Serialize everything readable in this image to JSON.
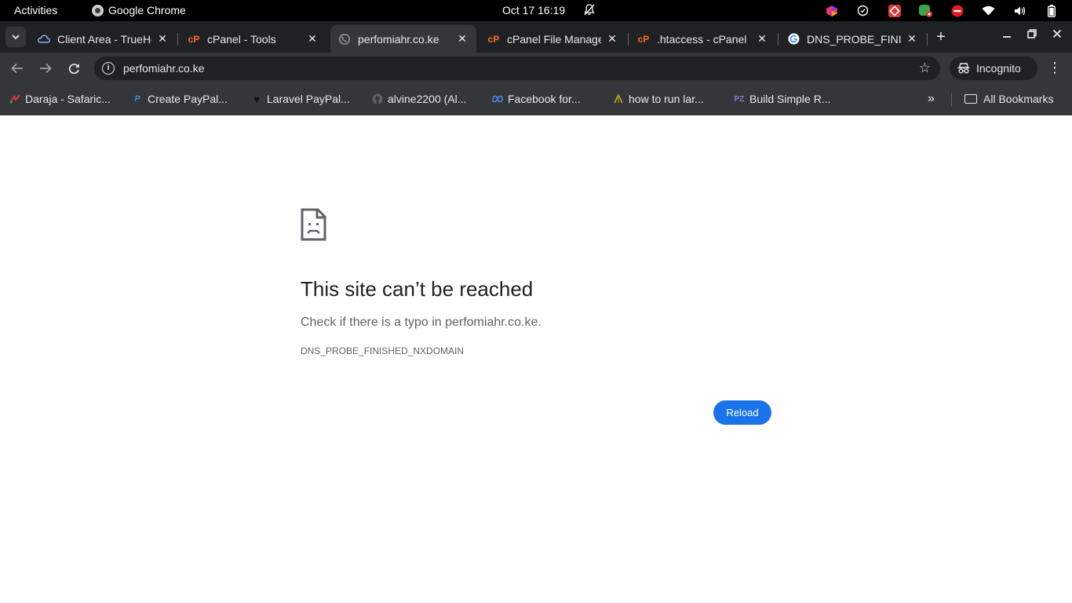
{
  "system_bar": {
    "activities_label": "Activities",
    "app_name": "Google Chrome",
    "clock": "Oct 17  16:19",
    "tray_icons": [
      "app-icon-1",
      "chat-icon",
      "app-icon-2",
      "update-icon",
      "dnd-icon",
      "wifi-icon",
      "volume-icon",
      "battery-icon"
    ]
  },
  "tabs": [
    {
      "title": "Client Area - TrueHost",
      "favicon": "cloud-icon"
    },
    {
      "title": "cPanel - Tools",
      "favicon": "cpanel-icon"
    },
    {
      "title": "perfomiahr.co.ke",
      "favicon": "globe-icon",
      "active": true
    },
    {
      "title": "cPanel File Manager",
      "favicon": "cpanel-icon"
    },
    {
      "title": ".htaccess - cPanel",
      "favicon": "cpanel-icon"
    },
    {
      "title": "DNS_PROBE_FINISHED_NXDOMAIN",
      "favicon": "google-icon"
    }
  ],
  "omnibox": {
    "url": "perfomiahr.co.ke"
  },
  "incognito_label": "Incognito",
  "bookmarks": [
    {
      "label": "Daraja - Safaric...",
      "icon": "daraja-icon"
    },
    {
      "label": "Create PayPal...",
      "icon": "paypal-icon"
    },
    {
      "label": "Laravel PayPal...",
      "icon": "heart-icon"
    },
    {
      "label": "alvine2200 (Al...",
      "icon": "github-icon"
    },
    {
      "label": "Facebook for...",
      "icon": "meta-icon"
    },
    {
      "label": "how to run lar...",
      "icon": "bookmark-icon"
    },
    {
      "label": "Build Simple R...",
      "icon": "pz-icon"
    }
  ],
  "all_bookmarks_label": "All Bookmarks",
  "error_page": {
    "title": "This site can’t be reached",
    "subtitle": "Check if there is a typo in perfomiahr.co.ke.",
    "error_code": "DNS_PROBE_FINISHED_NXDOMAIN",
    "reload_label": "Reload"
  },
  "colors": {
    "accent": "#1a73e8",
    "frame": "#202124",
    "toolbar": "#35363a",
    "cpanel": "#ff6c2c"
  }
}
